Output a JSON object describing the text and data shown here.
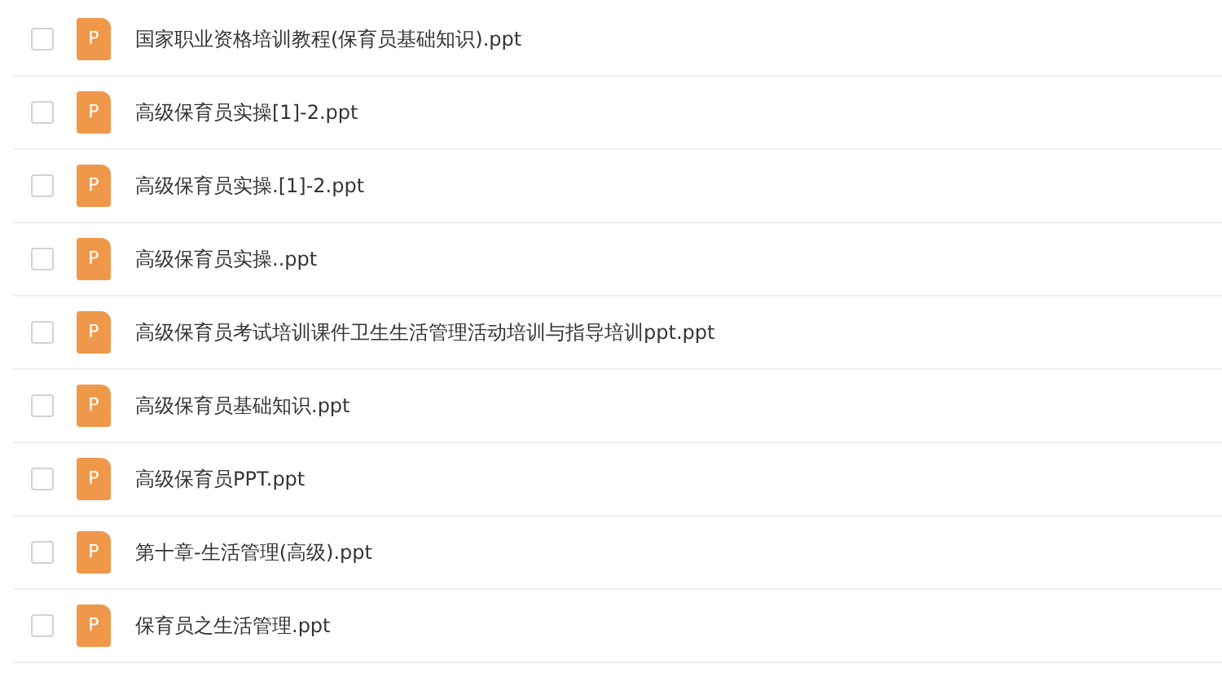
{
  "files": [
    {
      "name": "国家职业资格培训教程(保育员基础知识).ppt",
      "icon_letter": "P",
      "checked": false
    },
    {
      "name": "高级保育员实操[1]-2.ppt",
      "icon_letter": "P",
      "checked": false
    },
    {
      "name": "高级保育员实操.[1]-2.ppt",
      "icon_letter": "P",
      "checked": false
    },
    {
      "name": "高级保育员实操..ppt",
      "icon_letter": "P",
      "checked": false
    },
    {
      "name": "高级保育员考试培训课件卫生生活管理活动培训与指导培训ppt.ppt",
      "icon_letter": "P",
      "checked": false
    },
    {
      "name": "高级保育员基础知识.ppt",
      "icon_letter": "P",
      "checked": false
    },
    {
      "name": "高级保育员PPT.ppt",
      "icon_letter": "P",
      "checked": false
    },
    {
      "name": "第十章-生活管理(高级).ppt",
      "icon_letter": "P",
      "checked": false
    },
    {
      "name": "保育员之生活管理.ppt",
      "icon_letter": "P",
      "checked": false
    }
  ]
}
